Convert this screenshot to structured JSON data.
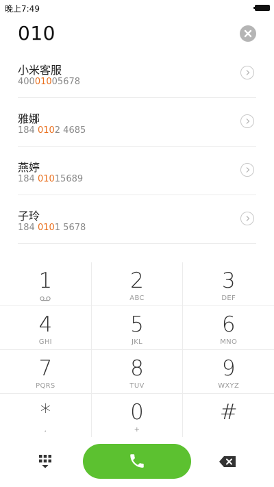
{
  "status_bar": {
    "time": "晚上7:49"
  },
  "dialer": {
    "input_value": "010"
  },
  "results": [
    {
      "name": "小米客服",
      "number_pre": "400",
      "number_match": "010",
      "number_post": "05678"
    },
    {
      "name": "雅娜",
      "number_pre": "184 ",
      "number_match": "010",
      "number_post": "2 4685"
    },
    {
      "name": "燕婷",
      "number_pre": "184 ",
      "number_match": "010",
      "number_post": "15689"
    },
    {
      "name": "子玲",
      "number_pre": "184 ",
      "number_match": "010",
      "number_post": "1 5678"
    }
  ],
  "keypad": {
    "keys": [
      {
        "digit": "1",
        "sub": ""
      },
      {
        "digit": "2",
        "sub": "ABC"
      },
      {
        "digit": "3",
        "sub": "DEF"
      },
      {
        "digit": "4",
        "sub": "GHI"
      },
      {
        "digit": "5",
        "sub": "JKL"
      },
      {
        "digit": "6",
        "sub": "MNO"
      },
      {
        "digit": "7",
        "sub": "PQRS"
      },
      {
        "digit": "8",
        "sub": "TUV"
      },
      {
        "digit": "9",
        "sub": "WXYZ"
      },
      {
        "digit": "*",
        "sub": ","
      },
      {
        "digit": "0",
        "sub": "+"
      },
      {
        "digit": "#",
        "sub": ""
      }
    ]
  },
  "colors": {
    "call_green": "#5cc130",
    "match_orange": "#e9701f",
    "divider": "#ececec"
  },
  "icons": {
    "clear": "clear-icon",
    "detail": "chevron-right-icon",
    "voicemail": "voicemail-icon",
    "dialpad": "dialpad-icon",
    "call": "phone-icon",
    "backspace": "backspace-icon"
  }
}
